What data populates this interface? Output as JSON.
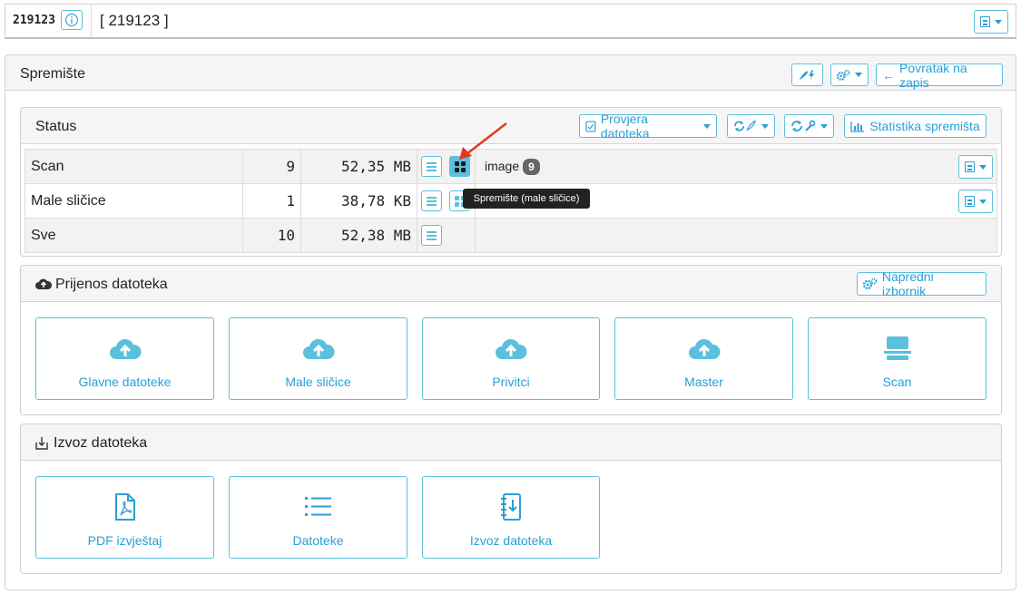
{
  "header": {
    "record_id": "219123",
    "record_title": "[ 219123 ]"
  },
  "storage": {
    "title": "Spremište",
    "back_label": "Povratak na zapis"
  },
  "status": {
    "title": "Status",
    "check_files_label": "Provjera datoteka",
    "stats_label": "Statistika spremišta",
    "rows": [
      {
        "name": "Scan",
        "count": "9",
        "size": "52,35 MB",
        "tag": "image",
        "tag_count": "9"
      },
      {
        "name": "Male sličice",
        "count": "1",
        "size": "38,78 KB"
      },
      {
        "name": "Sve",
        "count": "10",
        "size": "52,38 MB"
      }
    ],
    "tooltip": "Spremište (male sličice)"
  },
  "upload": {
    "title": "Prijenos datoteka",
    "advanced_label": "Napredni izbornik",
    "cards": [
      "Glavne datoteke",
      "Male sličice",
      "Privitci",
      "Master",
      "Scan"
    ]
  },
  "export": {
    "title": "Izvoz datoteka",
    "cards": [
      "PDF izvještaj",
      "Datoteke",
      "Izvoz datoteka"
    ]
  },
  "colors": {
    "accent": "#5bc0de",
    "accent_text": "#2a9fd6",
    "annotation_arrow": "#e03a1e"
  }
}
